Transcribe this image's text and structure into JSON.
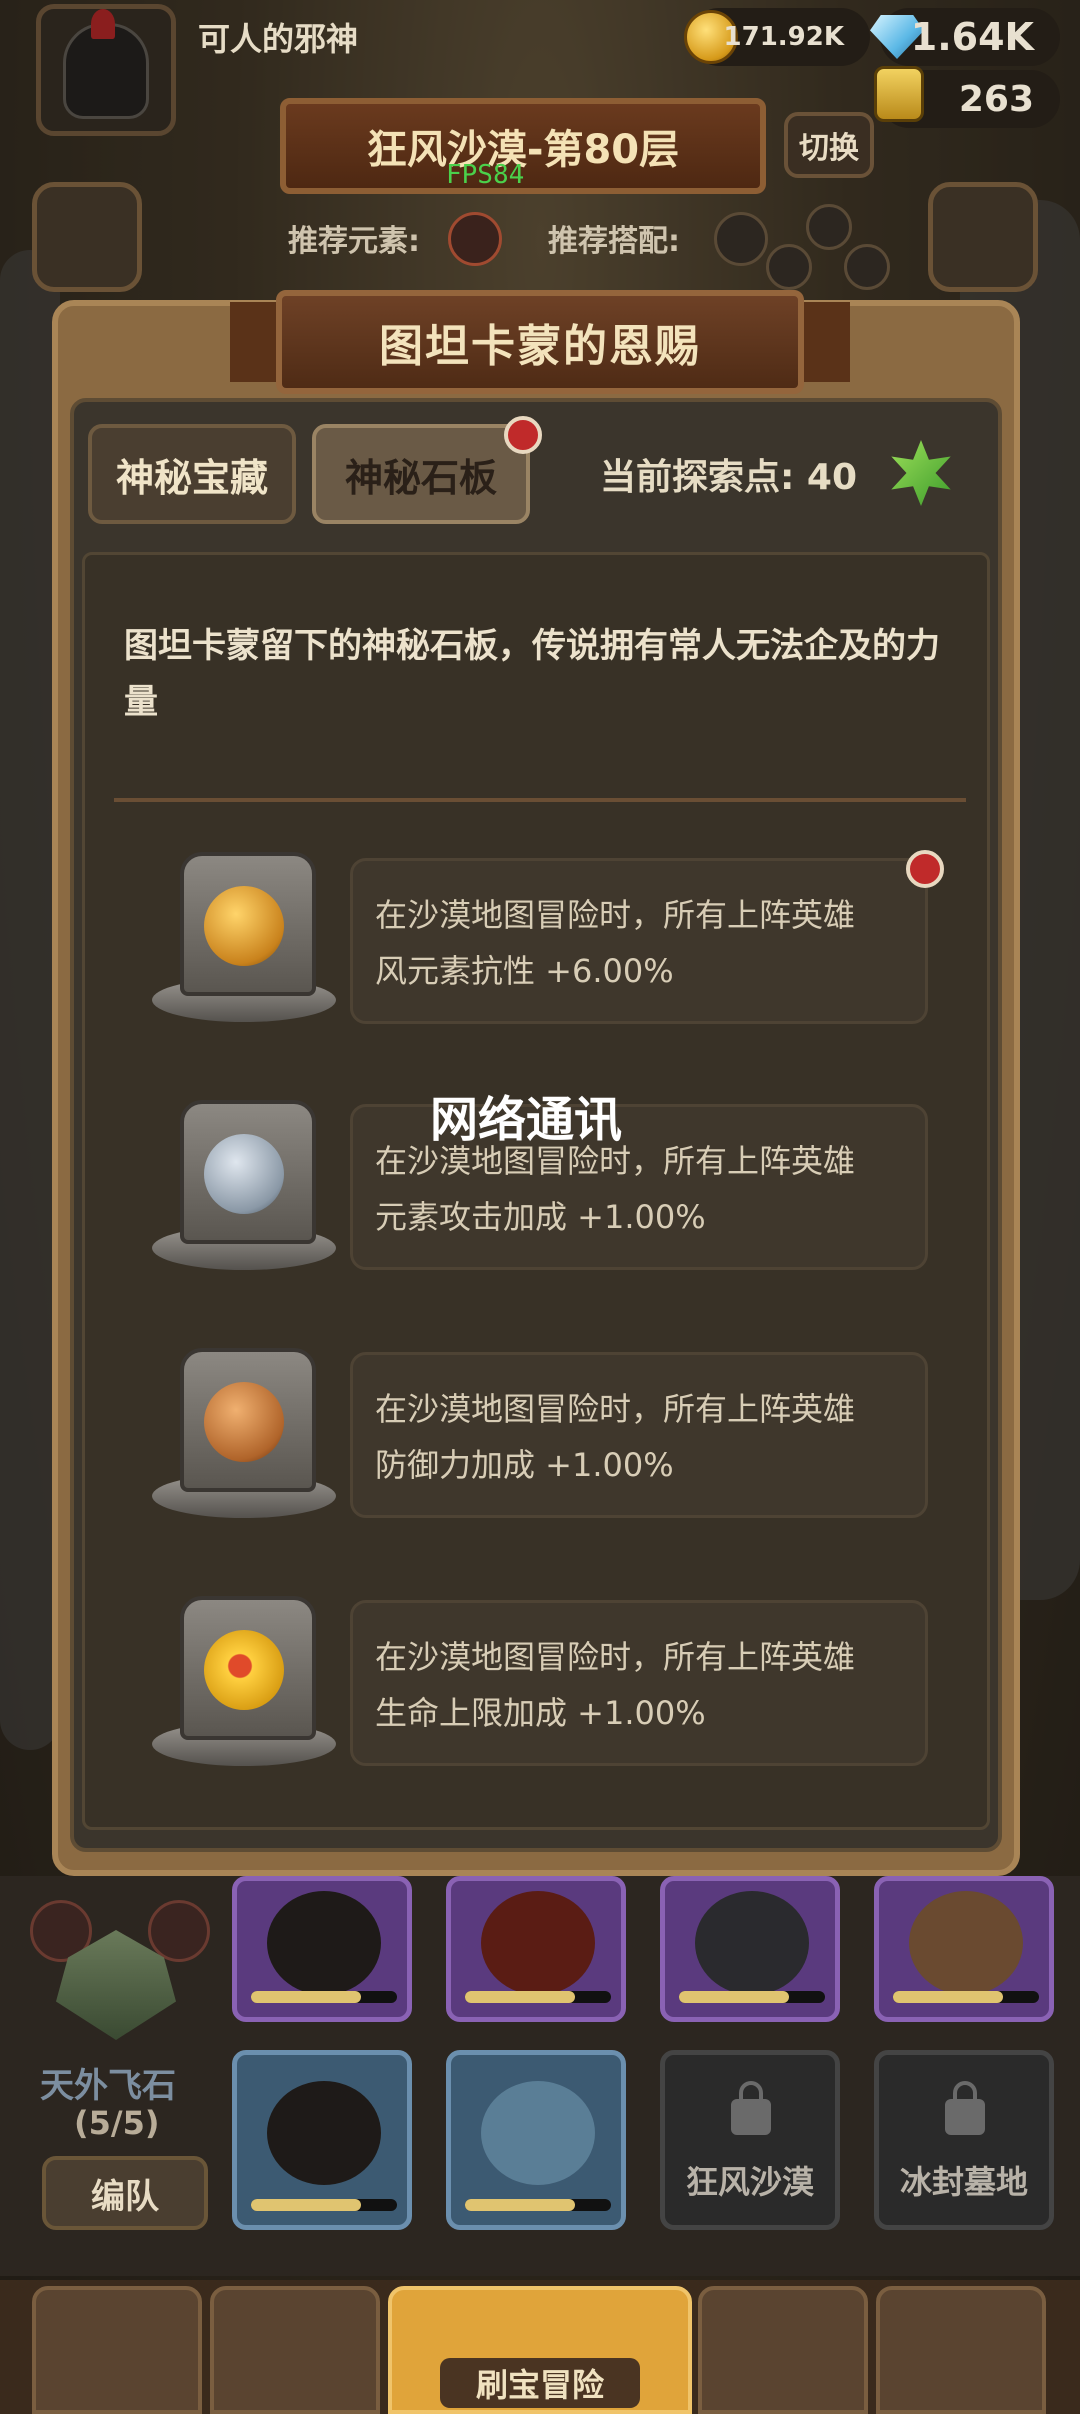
{
  "player": {
    "name": "可人的邪神"
  },
  "resources": {
    "gold": "171.92K",
    "gems": "1.64K",
    "other": "263"
  },
  "stage": {
    "title": "狂风沙漠-第80层",
    "switch_label": "切换",
    "fps": "FPS84"
  },
  "recommend": {
    "element_label": "推荐元素:",
    "combo_label": "推荐搭配:"
  },
  "modal": {
    "title": "图坦卡蒙的恩赐",
    "tabs": [
      {
        "label": "神秘宝藏",
        "active": false
      },
      {
        "label": "神秘石板",
        "active": true,
        "badge": true
      }
    ],
    "points_label": "当前探索点: 40",
    "description": "图坦卡蒙留下的神秘石板，传说拥有常人无法企及的力量",
    "items": [
      {
        "icon": "golden-cross-icon",
        "line1": "在沙漠地图冒险时，所有上阵英雄",
        "line2": "风元素抗性 +6.00%",
        "badge": true
      },
      {
        "icon": "sword-shield-icon",
        "line1": "在沙漠地图冒险时，所有上阵英雄",
        "line2": "元素攻击加成 +1.00%",
        "badge": false
      },
      {
        "icon": "dragon-icon",
        "line1": "在沙漠地图冒险时，所有上阵英雄",
        "line2": "防御力加成 +1.00%",
        "badge": false
      },
      {
        "icon": "flower-icon",
        "line1": "在沙漠地图冒险时，所有上阵英雄",
        "line2": "生命上限加成 +1.00%",
        "badge": false
      }
    ]
  },
  "toast": "网络通讯",
  "team": {
    "formation_name": "天外飞石",
    "formation_count": "(5/5)",
    "edit_label": "编队",
    "locked_slots": [
      "狂风沙漠",
      "冰封墓地"
    ]
  },
  "nav": {
    "center_label": "刷宝冒险"
  },
  "colors": {
    "accent_red": "#c02a2a",
    "panel_brown": "#8b6a42",
    "text_cream": "#ece2cc"
  }
}
